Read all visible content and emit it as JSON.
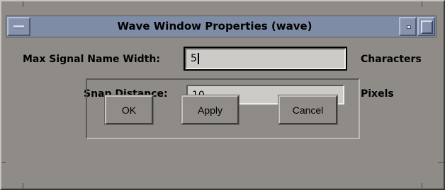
{
  "window": {
    "title": "Wave Window Properties (wave)"
  },
  "form": {
    "max_signal_name_width": {
      "label": "Max Signal Name Width:",
      "value": "5",
      "unit": "Characters"
    },
    "snap_distance": {
      "label": "Snap Distance:",
      "value": "10",
      "unit": "Pixels"
    }
  },
  "buttons": {
    "ok": "OK",
    "apply": "Apply",
    "cancel": "Cancel"
  },
  "colors": {
    "background": "#8f8b87",
    "titlebar": "#7f8ca6",
    "field": "#cdcbc8"
  }
}
